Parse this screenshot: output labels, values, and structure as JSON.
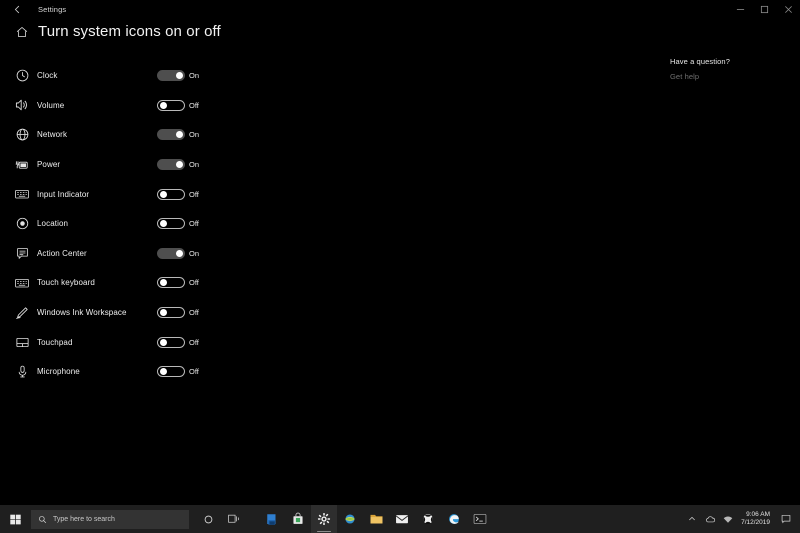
{
  "window": {
    "title": "Settings",
    "back_icon": "back-arrow-icon",
    "controls": {
      "minimize": "minimize-icon",
      "maximize": "maximize-icon",
      "close": "close-icon"
    }
  },
  "page": {
    "home_icon": "home-icon",
    "title": "Turn system icons on or off"
  },
  "settings": [
    {
      "icon": "clock-icon",
      "label": "Clock",
      "state": "On",
      "on": true
    },
    {
      "icon": "volume-icon",
      "label": "Volume",
      "state": "Off",
      "on": false
    },
    {
      "icon": "network-icon",
      "label": "Network",
      "state": "On",
      "on": true
    },
    {
      "icon": "power-icon",
      "label": "Power",
      "state": "On",
      "on": true
    },
    {
      "icon": "keyboard-icon",
      "label": "Input Indicator",
      "state": "Off",
      "on": false
    },
    {
      "icon": "location-icon",
      "label": "Location",
      "state": "Off",
      "on": false
    },
    {
      "icon": "action-center-icon",
      "label": "Action Center",
      "state": "On",
      "on": true
    },
    {
      "icon": "touch-keyboard-icon",
      "label": "Touch keyboard",
      "state": "Off",
      "on": false
    },
    {
      "icon": "pen-icon",
      "label": "Windows Ink Workspace",
      "state": "Off",
      "on": false
    },
    {
      "icon": "touchpad-icon",
      "label": "Touchpad",
      "state": "Off",
      "on": false
    },
    {
      "icon": "microphone-icon",
      "label": "Microphone",
      "state": "Off",
      "on": false
    }
  ],
  "help": {
    "title": "Have a question?",
    "link": "Get help"
  },
  "taskbar": {
    "start_icon": "windows-start-icon",
    "search": {
      "icon": "search-icon",
      "placeholder": "Type here to search"
    },
    "cortana_icon": "cortana-circle-icon",
    "taskview_icon": "task-view-icon",
    "apps": [
      {
        "name": "microsoft-store-icon",
        "active": false
      },
      {
        "name": "shopping-bag-icon",
        "active": false
      },
      {
        "name": "settings-gear-icon",
        "active": true
      },
      {
        "name": "browser-globe-icon",
        "active": false
      },
      {
        "name": "file-explorer-icon",
        "active": false
      },
      {
        "name": "mail-icon",
        "active": false
      },
      {
        "name": "xbox-icon",
        "active": false
      },
      {
        "name": "edge-browser-icon",
        "active": false
      },
      {
        "name": "command-prompt-icon",
        "active": false
      }
    ],
    "tray": {
      "chevron_icon": "chevron-up-icon",
      "onedrive_icon": "cloud-icon",
      "network_icon": "wifi-icon",
      "time": "9:06 AM",
      "date": "7/12/2019",
      "action_center_icon": "action-center-tray-icon"
    }
  },
  "colors": {
    "background": "#000000",
    "toggle_on_fill": "#4e4e4e",
    "toggle_border_off": "#b9b9b9",
    "taskbar": "#1f1f1f",
    "search_box": "#333333",
    "link": "#6f6f6f"
  }
}
